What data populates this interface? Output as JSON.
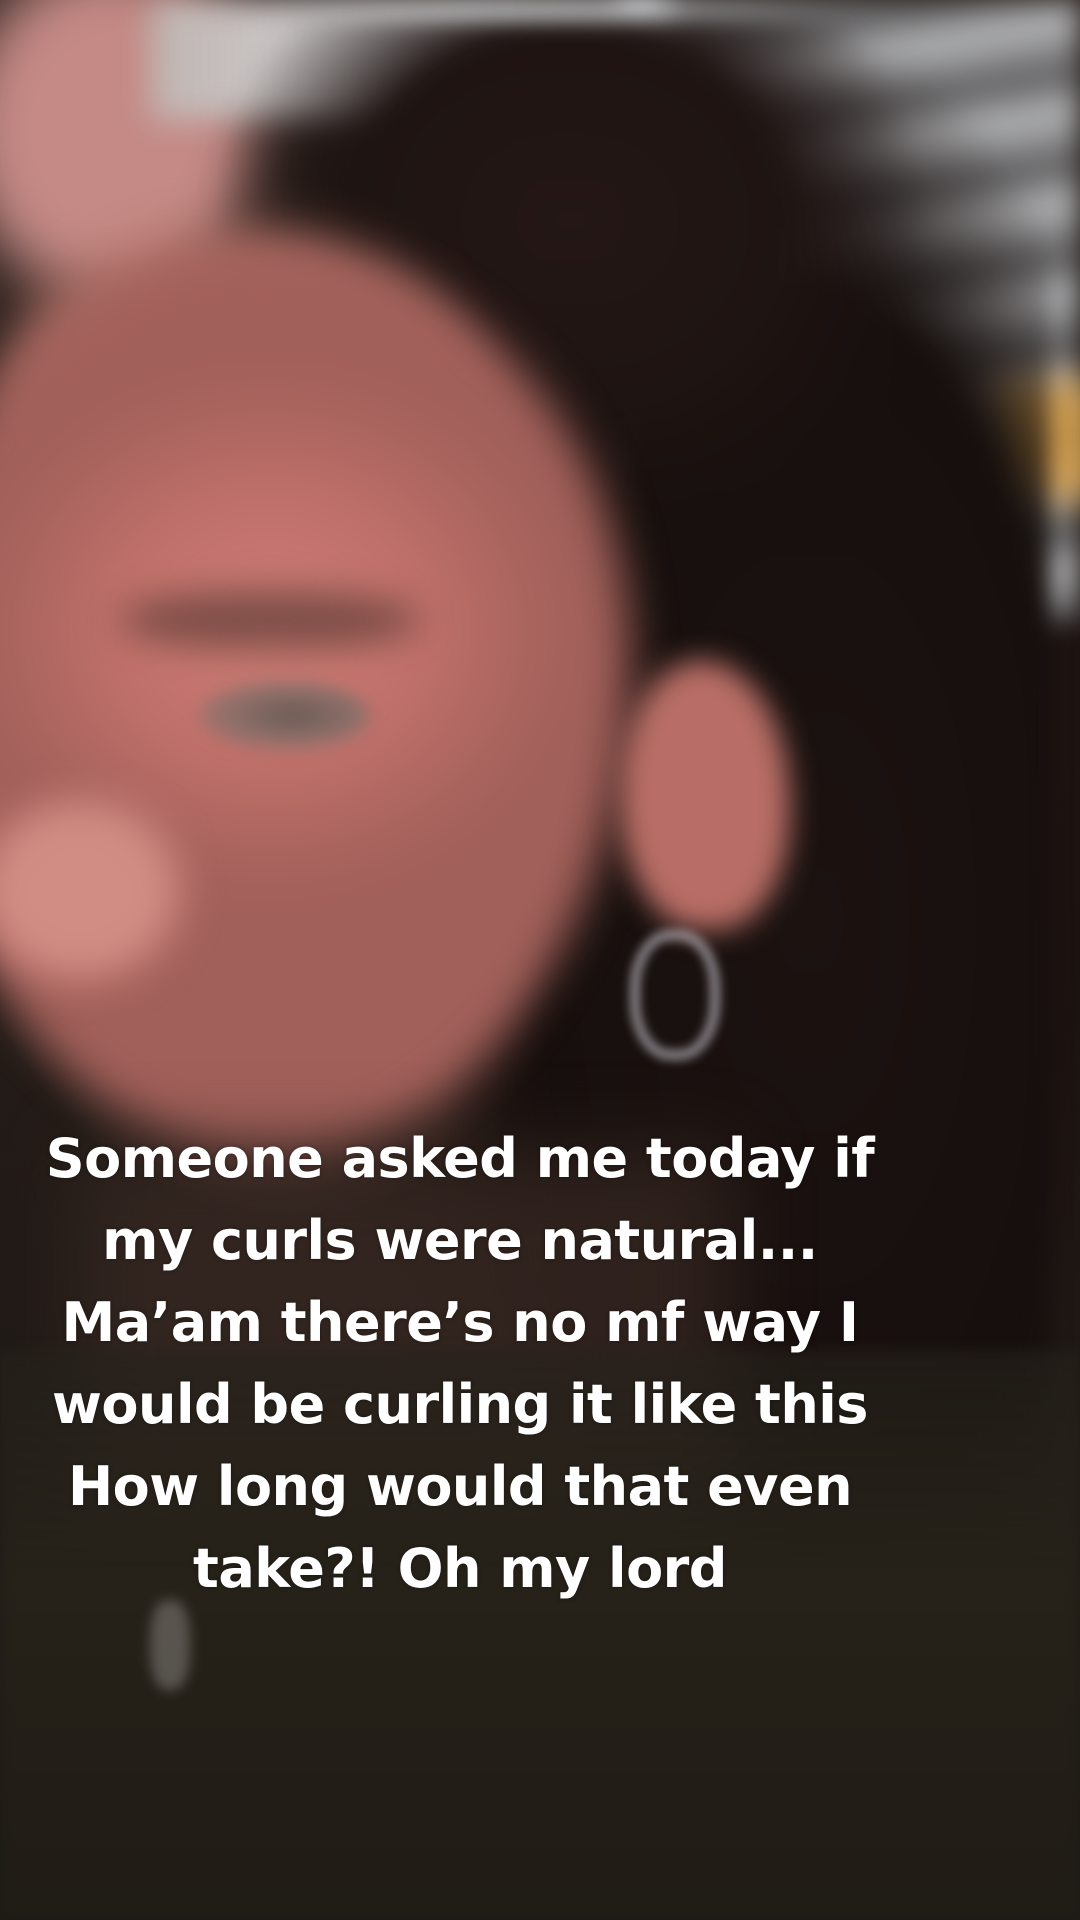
{
  "caption": {
    "lines": [
      "Someone asked me today if",
      "my curls were natural...",
      "Ma’am there’s no mf way I",
      "would be curling it like this",
      "How long would that even",
      "take?! Oh my lord"
    ]
  }
}
